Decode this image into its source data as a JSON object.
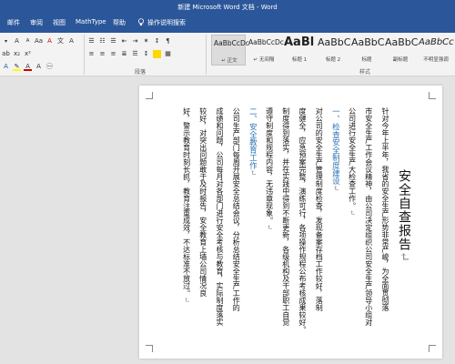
{
  "window": {
    "title": "新建 Microsoft Word 文档 - Word"
  },
  "tabs": [
    {
      "label": "邮件"
    },
    {
      "label": "审阅"
    },
    {
      "label": "视图"
    },
    {
      "label": "MathType"
    },
    {
      "label": "帮助"
    }
  ],
  "tell_me": {
    "label": "操作说明搜索"
  },
  "ribbon": {
    "groups": {
      "paragraph": "段落",
      "styles": "样式"
    },
    "styles": [
      {
        "sample": "AaBbCcDc",
        "name": "↵ 正文"
      },
      {
        "sample": "AaBbCcDc",
        "name": "↵ 无间隔"
      },
      {
        "sample": "AaBl",
        "name": "标题 1"
      },
      {
        "sample": "AaBbC",
        "name": "标题 2"
      },
      {
        "sample": "AaBbC",
        "name": "标题"
      },
      {
        "sample": "AaBbC",
        "name": "副标题"
      },
      {
        "sample": "AaBbCc",
        "name": "不明显强调"
      }
    ]
  },
  "document": {
    "title": "安全自查报告",
    "columns": [
      "针对今年上半年，我省的安全生产形势非常严峻，为全面贯彻落",
      "市安全生产工作会议精神，由公司决定组织公司安全生产领导小组对",
      "公司进行安全生产大检查工作。",
      "一、检查安全制度建设",
      "对公司的安全生产管理制度检查，发现备案存档工作较好，落制",
      "度健全，应急预案完整，演练可行，各项操作规程公布考核成果较好。",
      "制度得到落实，并在实践中得到不断更新，各级机构及干部职工自觉",
      "遵守制度和规程内容，无违章现象。",
      "二、安全教育工作",
      "公司生产部门每周开展安全总结会议，分析总结安全生产工作的",
      "成绩和问题，公司每月对各部门进行安全考核与教育，实际制度落实",
      "较好，对突出问题敢于及时报告，安全教育上墙公司情况良",
      "好，警示教育时刻长抓，教育注重成效，不达标准不放过。"
    ],
    "column_kinds": [
      "body",
      "body",
      "body",
      "heading",
      "body",
      "body",
      "body",
      "body",
      "heading",
      "body",
      "body",
      "body",
      "body"
    ],
    "para_ends": [
      2,
      3,
      7,
      8,
      12
    ]
  },
  "colors": {
    "word_blue": "#2b579a",
    "heading_blue": "#2e74b5"
  }
}
